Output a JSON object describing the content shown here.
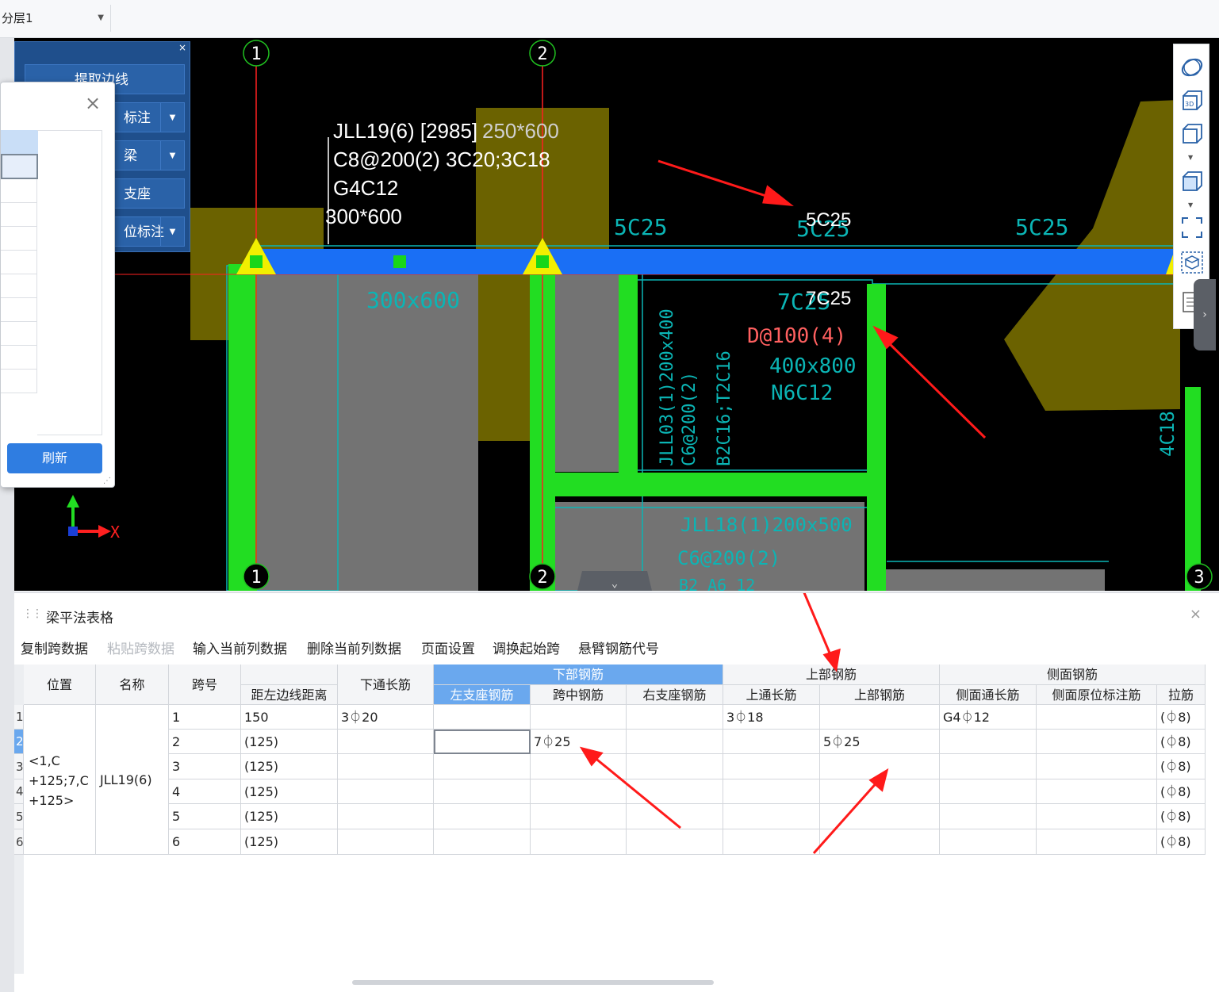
{
  "topbar": {
    "layer_select": "分层1"
  },
  "tool_panel": {
    "close": "×",
    "buttons": [
      "提取边线",
      "标注",
      "梁",
      "支座",
      "位标注"
    ]
  },
  "dialog": {
    "close": "×",
    "refresh": "刷新"
  },
  "canvas": {
    "axis_labels": [
      "1",
      "2",
      "1",
      "2",
      "3"
    ],
    "beam_annotation": [
      "JLL19(6) [2985]",
      "250*600",
      "C8@200(2) 3C20;3C18",
      "G4C12",
      "300*600"
    ],
    "cad_texts": {
      "t5c25a": "5C25",
      "t5c25b": "5C25",
      "t5c25c": "5C25",
      "t5c25white": "5C25",
      "t7c25": "7C25",
      "t7c25white": "7C25",
      "t300x600": "300x600",
      "tstirrup": "D@100(4)",
      "t400x800": "400x800",
      "tn6c12": "N6C12",
      "tjll03a": "JLL03(1)200x400",
      "tjll03b": "C6@200(2)",
      "tjll03c": "B2C16;T2C16",
      "tjll18a": "JLL18(1)200x500",
      "tjll18b": "C6@200(2)",
      "tjll18c": "B2 A6 12",
      "t4c18": "4C18"
    },
    "ucs": {
      "x_label": "X"
    }
  },
  "right_toolbar": {
    "icons": [
      "orbit-icon",
      "view-3d-icon",
      "cube-outline-icon",
      "cube-solid-icon",
      "fit-view-icon",
      "box-select-icon",
      "list-icon"
    ]
  },
  "table_panel": {
    "title": "梁平法表格",
    "close": "×",
    "menu": [
      "复制跨数据",
      "粘贴跨数据",
      "输入当前列数据",
      "删除当前列数据",
      "页面设置",
      "调换起始跨",
      "悬臂钢筋代号"
    ],
    "headers": {
      "position": "位置",
      "name": "名称",
      "span": "跨号",
      "dist": "距左边线距离",
      "bottom_through": "下通长筋",
      "bottom_group": "下部钢筋",
      "left_support": "左支座钢筋",
      "mid_span": "跨中钢筋",
      "right_support": "右支座钢筋",
      "top_group": "上部钢筋",
      "top_through": "上通长筋",
      "top_bar": "上部钢筋",
      "side_group": "侧面钢筋",
      "side_through": "侧面通长筋",
      "side_orig": "侧面原位标注筋",
      "tie": "拉筋"
    },
    "position_value": "<1,C +125;7,C +125>",
    "name_value": "JLL19(6)",
    "rows": [
      {
        "num": "1",
        "span": "1",
        "dist": "150",
        "bottom_through": "3⏀20",
        "left": "",
        "mid": "",
        "right": "",
        "top_through": "3⏀18",
        "top": "",
        "side_through": "G4⏀12",
        "side_orig": "",
        "tie": "(⏀8)"
      },
      {
        "num": "2",
        "span": "2",
        "dist": "(125)",
        "bottom_through": "",
        "left": "",
        "mid": "7⏀25",
        "right": "",
        "top_through": "",
        "top": "5⏀25",
        "side_through": "",
        "side_orig": "",
        "tie": "(⏀8)"
      },
      {
        "num": "3",
        "span": "3",
        "dist": "(125)",
        "bottom_through": "",
        "left": "",
        "mid": "",
        "right": "",
        "top_through": "",
        "top": "",
        "side_through": "",
        "side_orig": "",
        "tie": "(⏀8)"
      },
      {
        "num": "4",
        "span": "4",
        "dist": "(125)",
        "bottom_through": "",
        "left": "",
        "mid": "",
        "right": "",
        "top_through": "",
        "top": "",
        "side_through": "",
        "side_orig": "",
        "tie": "(⏀8)"
      },
      {
        "num": "5",
        "span": "5",
        "dist": "(125)",
        "bottom_through": "",
        "left": "",
        "mid": "",
        "right": "",
        "top_through": "",
        "top": "",
        "side_through": "",
        "side_orig": "",
        "tie": "(⏀8)"
      },
      {
        "num": "6",
        "span": "6",
        "dist": "(125)",
        "bottom_through": "",
        "left": "",
        "mid": "",
        "right": "",
        "top_through": "",
        "top": "",
        "side_through": "",
        "side_orig": "",
        "tie": "(⏀8)"
      }
    ]
  },
  "colors": {
    "beam_blue": "#1a6ff5",
    "column_green": "#22dd22",
    "olive": "#6b6200",
    "arrow_red": "#ff1a1a",
    "cad_cyan": "#0bb5b5"
  }
}
